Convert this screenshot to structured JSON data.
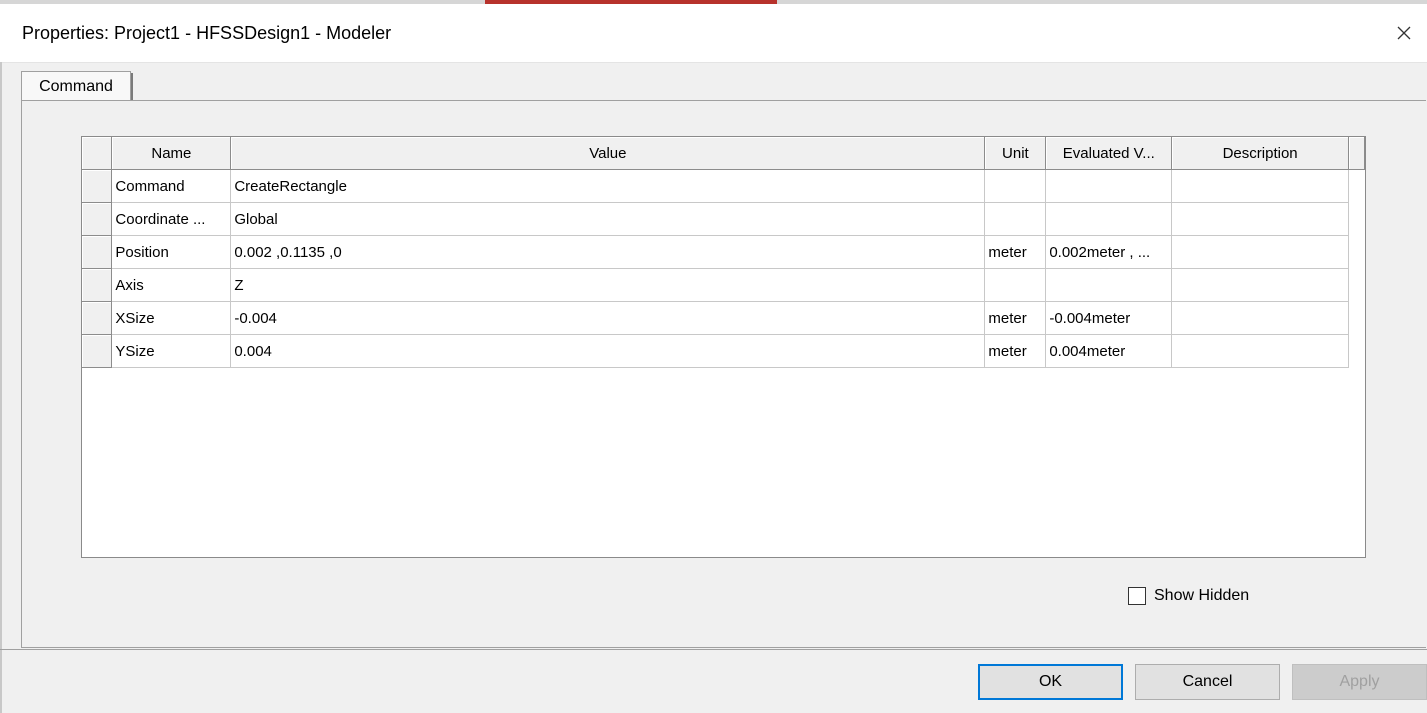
{
  "window": {
    "title": "Properties: Project1 - HFSSDesign1 - Modeler"
  },
  "tabs": [
    {
      "label": "Command"
    }
  ],
  "table": {
    "columns": [
      "Name",
      "Value",
      "Unit",
      "Evaluated V...",
      "Description"
    ],
    "rows": [
      {
        "name": "Command",
        "value": "CreateRectangle",
        "unit": "",
        "evaluated": "",
        "description": ""
      },
      {
        "name": "Coordinate ...",
        "value": "Global",
        "unit": "",
        "evaluated": "",
        "description": ""
      },
      {
        "name": "Position",
        "value": "0.002 ,0.1135 ,0",
        "unit": "meter",
        "evaluated": "0.002meter , ...",
        "description": ""
      },
      {
        "name": "Axis",
        "value": "Z",
        "unit": "",
        "evaluated": "",
        "description": ""
      },
      {
        "name": "XSize",
        "value": "-0.004",
        "unit": "meter",
        "evaluated": "-0.004meter",
        "description": ""
      },
      {
        "name": "YSize",
        "value": "0.004",
        "unit": "meter",
        "evaluated": "0.004meter",
        "description": ""
      }
    ]
  },
  "options": {
    "show_hidden_label": "Show Hidden",
    "show_hidden_checked": false
  },
  "buttons": {
    "ok": "OK",
    "cancel": "Cancel",
    "apply": "Apply"
  }
}
